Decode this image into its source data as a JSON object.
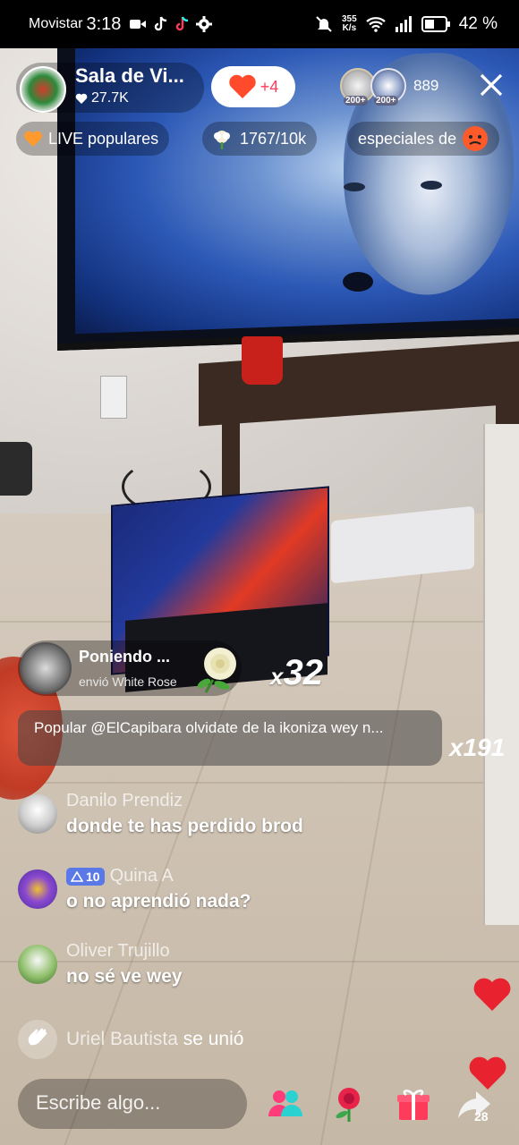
{
  "status_bar": {
    "carrier": "Movistar",
    "time": "3:18",
    "net_speed": "355",
    "net_speed_unit": "K/s",
    "battery": "42 %"
  },
  "header": {
    "host_name": "Sala de Vi...",
    "host_likes": "27.7K",
    "follow_count": "+4",
    "viewer_badges": [
      "200+",
      "200+"
    ],
    "viewer_count": "889"
  },
  "pills": {
    "live_popular": "LIVE populares",
    "goal_progress": "1767/10k",
    "specials": "especiales de"
  },
  "gift": {
    "user": "Poniendo ...",
    "sent_text": "envió White Rose",
    "combo_prefix": "x",
    "combo_count": "32"
  },
  "popular": {
    "text": "Popular @ElCapibara olvidate de la ikoniza wey n...",
    "combo": "x191"
  },
  "chat": [
    {
      "user": "Danilo Prendiz",
      "text": "donde te has perdido brod",
      "badge": null
    },
    {
      "user": "Quina A",
      "text": "o no aprendió nada?",
      "badge": "10"
    },
    {
      "user": "Oliver Trujillo",
      "text": "no sé ve wey",
      "badge": null
    }
  ],
  "join": {
    "user": "Uriel Bautista",
    "text": "se unió"
  },
  "bottom_bar": {
    "input_placeholder": "Escribe algo...",
    "share_count": "28",
    "icons": [
      "multi-guest-icon",
      "rose-gift-icon",
      "gift-box-icon",
      "share-icon"
    ]
  },
  "colors": {
    "accent_red": "#ff3b5c",
    "heart_red": "#e8232f",
    "level_badge": "#5a78e8"
  }
}
